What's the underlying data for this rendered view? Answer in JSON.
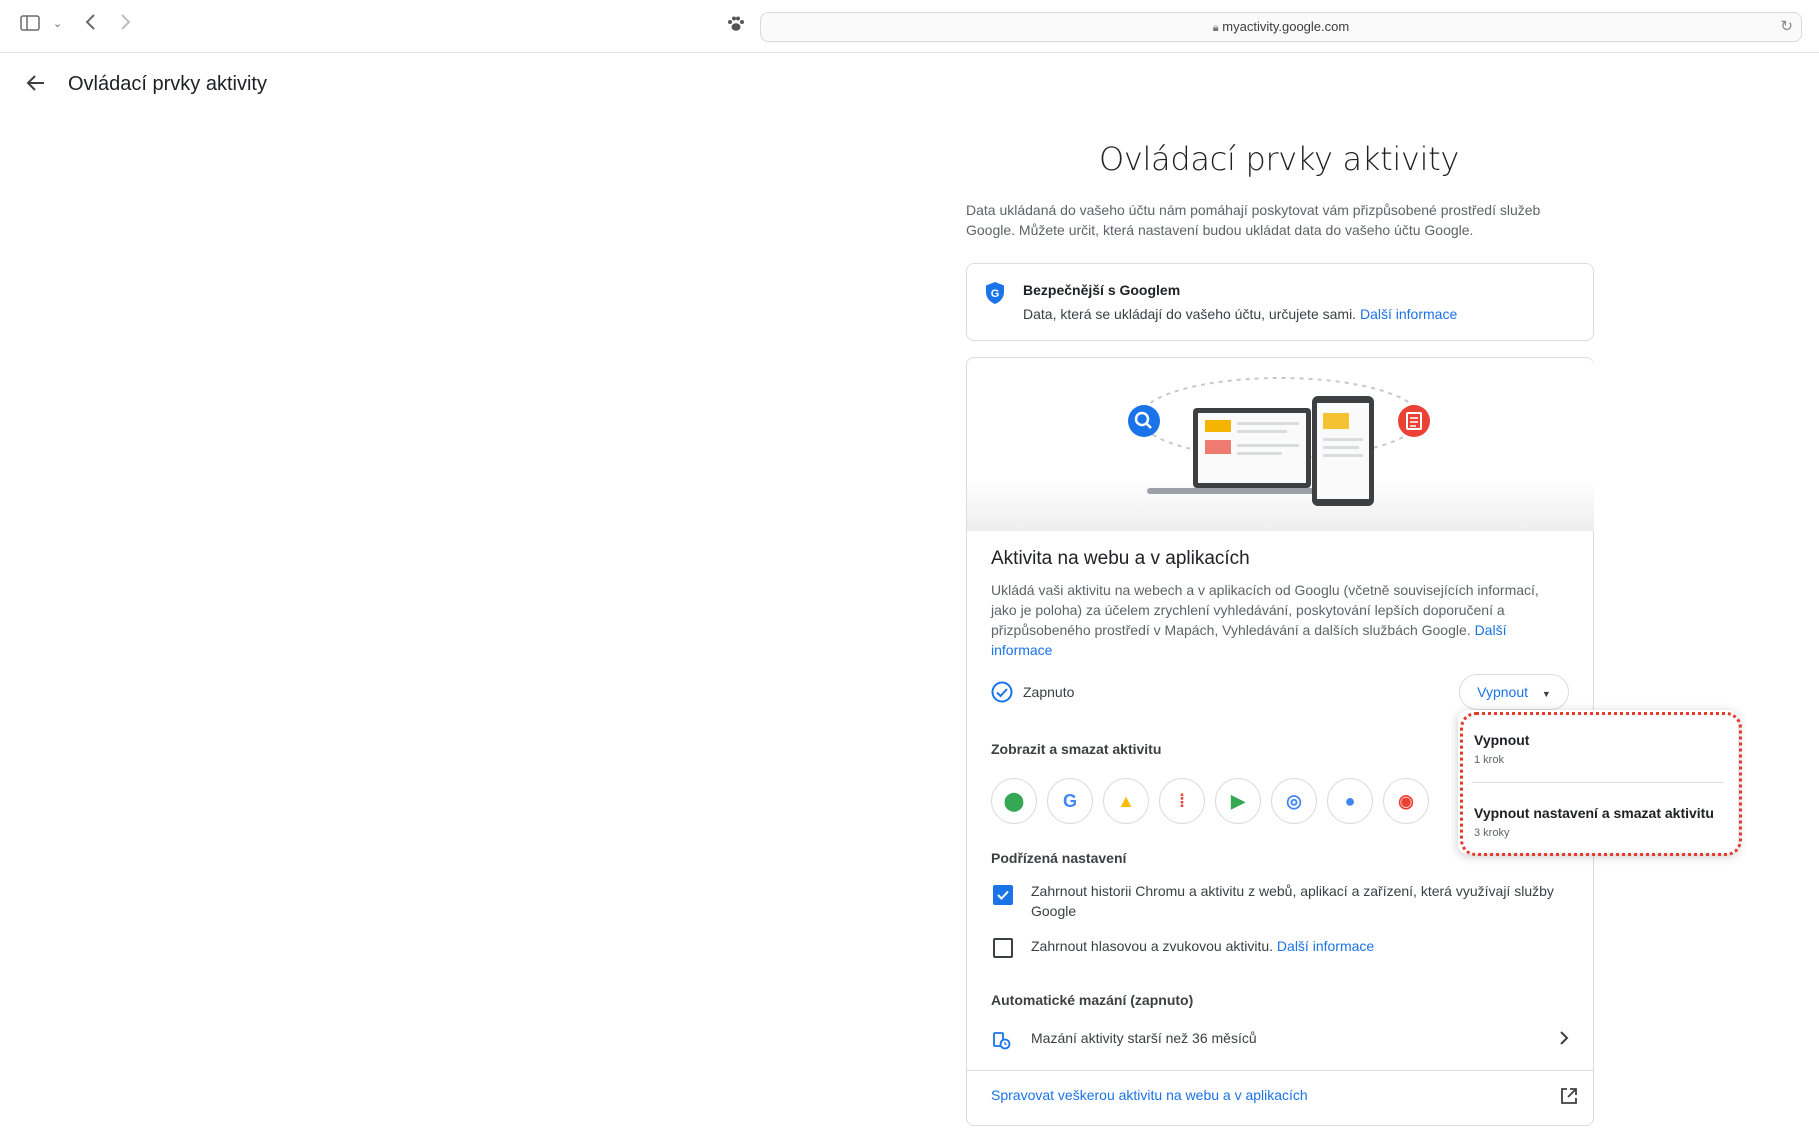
{
  "browser": {
    "url": "myactivity.google.com"
  },
  "header": {
    "title": "Ovládací prvky aktivity"
  },
  "main": {
    "title": "Ovládací prvky aktivity",
    "intro": "Data ukládaná do vašeho účtu nám pomáhají poskytovat vám přizpůsobené prostředí služeb Google. Můžete určit, která nastavení budou ukládat data do vašeho účtu Google."
  },
  "safer_card": {
    "title": "Bezpečnější s Googlem",
    "text": "Data, která se ukládají do vašeho účtu, určujete sami.",
    "link": "Další informace"
  },
  "activity_card": {
    "title": "Aktivita na webu a v aplikacích",
    "description": "Ukládá vaši aktivitu na webech a v aplikacích od Googlu (včetně souvisejících informací, jako je poloha) za účelem zrychlení vyhledávání, poskytování lepších doporučení a přizpůsobeného prostředí v Mapách, Vyhledávání a dalších službách Google.",
    "description_link": "Další informace",
    "status": "Zapnuto",
    "off_button": "Vypnout",
    "view_delete_heading": "Zobrazit a smazat aktivitu",
    "products": [
      {
        "name": "maps-icon",
        "glyph": "⬤",
        "color": "#34a853"
      },
      {
        "name": "google-icon",
        "glyph": "G",
        "color": "#4285f4"
      },
      {
        "name": "ads-icon",
        "glyph": "▲",
        "color": "#fbbc04"
      },
      {
        "name": "podcasts-icon",
        "glyph": "⁞",
        "color": "#ea4335"
      },
      {
        "name": "play-icon",
        "glyph": "▶",
        "color": "#34a853"
      },
      {
        "name": "lens-icon",
        "glyph": "◎",
        "color": "#4285f4"
      },
      {
        "name": "assistant-icon",
        "glyph": "●",
        "color": "#4285f4"
      },
      {
        "name": "chrome-icon",
        "glyph": "◉",
        "color": "#ea4335"
      }
    ],
    "sub_settings_heading": "Podřízená nastavení",
    "checkbox_chrome": "Zahrnout historii Chromu a aktivitu z webů, aplikací a zařízení, která využívají služby Google",
    "checkbox_voice": "Zahrnout hlasovou a zvukovou aktivitu.",
    "checkbox_voice_link": "Další informace",
    "auto_delete_heading": "Automatické mazání (zapnuto)",
    "auto_delete_text": "Mazání aktivity starší než 36 měsíců",
    "manage_link": "Spravovat veškerou aktivitu na webu a v aplikacích"
  },
  "dropdown": {
    "items": [
      {
        "title": "Vypnout",
        "sub": "1 krok"
      },
      {
        "title": "Vypnout nastavení a smazat aktivitu",
        "sub": "3 kroky"
      }
    ]
  },
  "colors": {
    "accent": "#1a73e8",
    "highlight": "#e43a2a"
  }
}
